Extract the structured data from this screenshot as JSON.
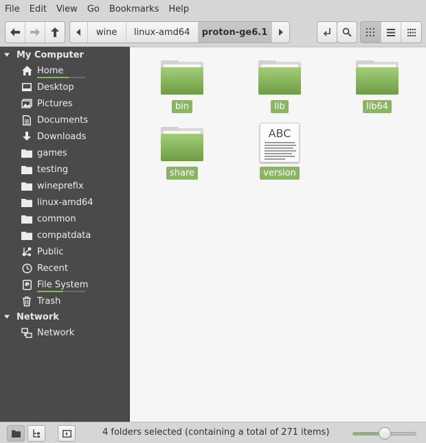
{
  "menubar": {
    "items": [
      "File",
      "Edit",
      "View",
      "Go",
      "Bookmarks",
      "Help"
    ]
  },
  "breadcrumb": {
    "items": [
      "wine",
      "linux-amd64",
      "proton-ge6.1"
    ],
    "active": "proton-ge6.1"
  },
  "sidebar": {
    "sections": [
      {
        "title": "My Computer",
        "items": [
          {
            "label": "Home",
            "icon": "home-icon",
            "usage": 0.66
          },
          {
            "label": "Desktop",
            "icon": "desktop-icon"
          },
          {
            "label": "Pictures",
            "icon": "pictures-icon"
          },
          {
            "label": "Documents",
            "icon": "documents-icon"
          },
          {
            "label": "Downloads",
            "icon": "downloads-icon"
          },
          {
            "label": "games",
            "icon": "folder-icon"
          },
          {
            "label": "testing",
            "icon": "folder-icon"
          },
          {
            "label": "wineprefix",
            "icon": "folder-icon"
          },
          {
            "label": "linux-amd64",
            "icon": "folder-icon"
          },
          {
            "label": "common",
            "icon": "folder-icon"
          },
          {
            "label": "compatdata",
            "icon": "folder-icon"
          },
          {
            "label": "Public",
            "icon": "share-icon"
          },
          {
            "label": "Recent",
            "icon": "clock-icon"
          },
          {
            "label": "File System",
            "icon": "drive-icon",
            "usage": 0.55
          },
          {
            "label": "Trash",
            "icon": "trash-icon"
          }
        ]
      },
      {
        "title": "Network",
        "items": [
          {
            "label": "Network",
            "icon": "network-icon"
          }
        ]
      }
    ]
  },
  "files": [
    {
      "name": "bin",
      "type": "folder",
      "selected": true
    },
    {
      "name": "lib",
      "type": "folder",
      "selected": true
    },
    {
      "name": "lib64",
      "type": "folder",
      "selected": true
    },
    {
      "name": "share",
      "type": "folder",
      "selected": true
    },
    {
      "name": "version",
      "type": "text",
      "thumb": "ABC",
      "selected": false
    }
  ],
  "status": {
    "text": "4 folders selected (containing a total of 271 items), ..."
  },
  "zoom": {
    "level": 0.5
  },
  "colors": {
    "accent": "#8cb465",
    "sidebar_bg": "#4a4a4a",
    "content_bg": "#f6f6f6"
  }
}
